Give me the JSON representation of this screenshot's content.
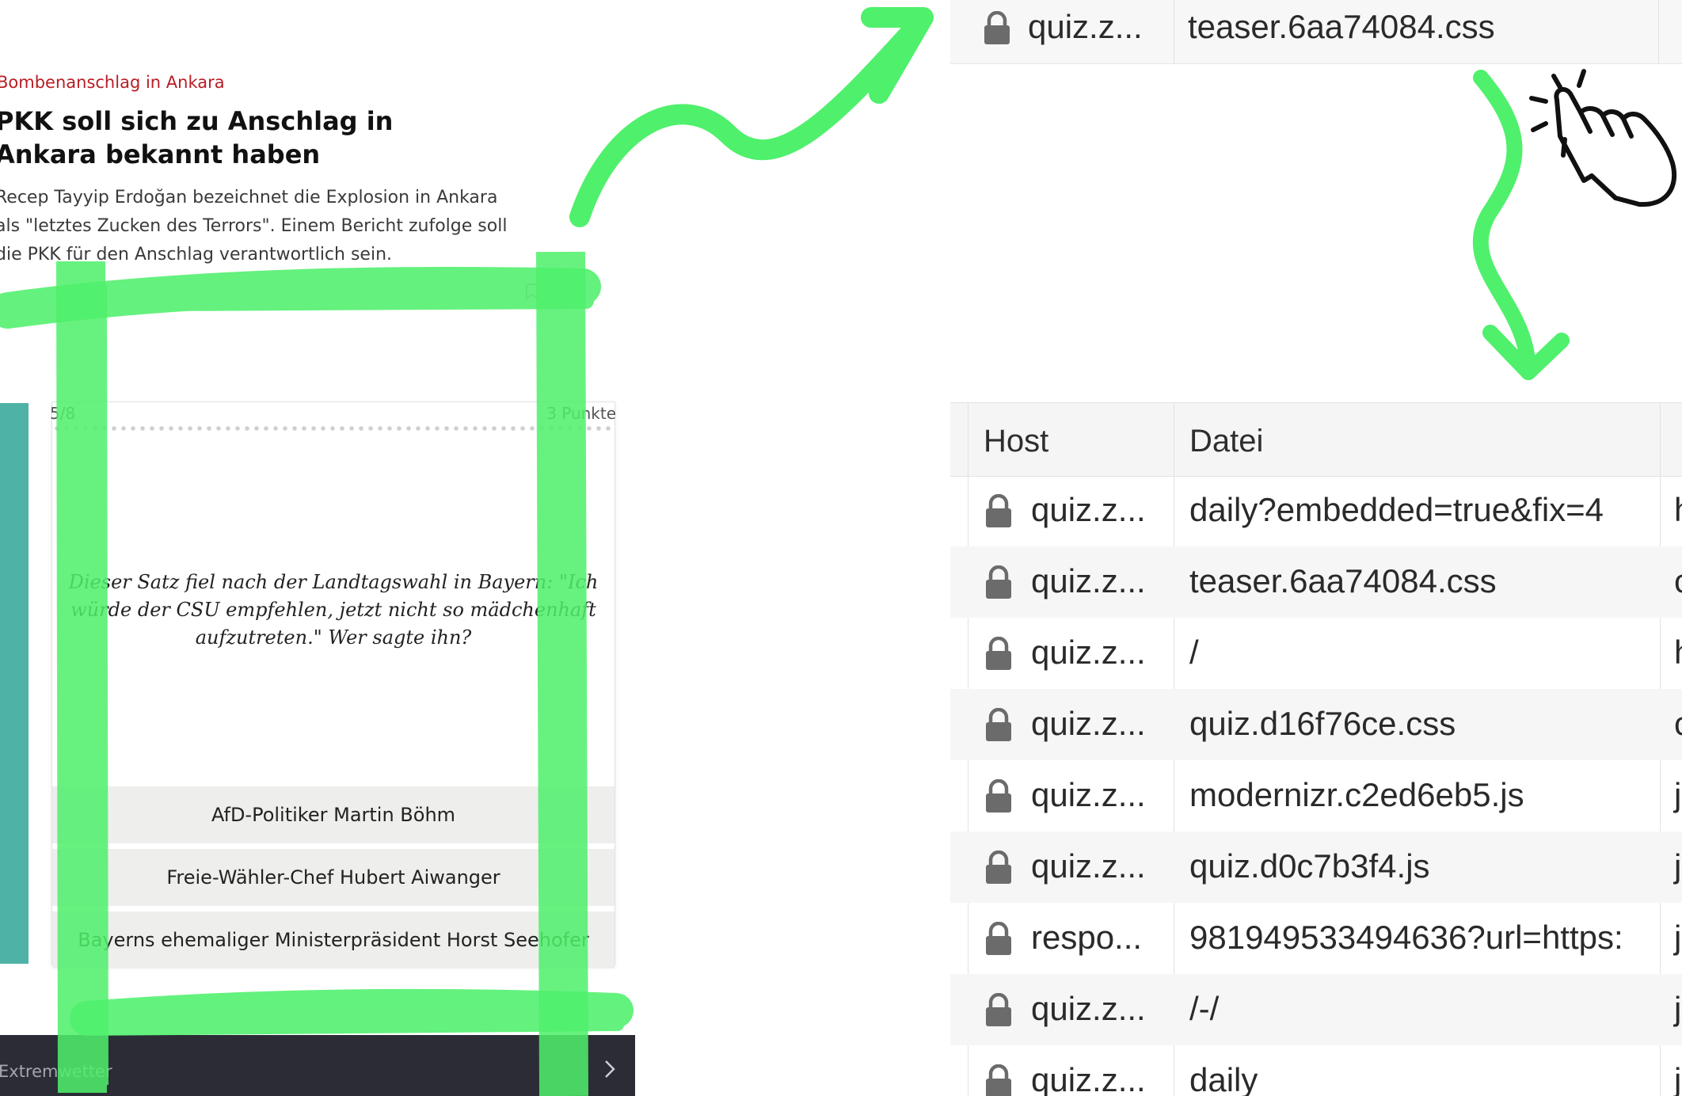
{
  "article": {
    "kicker": "Bombenanschlag in Ankara",
    "headline": "PKK soll sich zu Anschlag in Ankara bekannt haben",
    "teaser": "Recep Tayyip Erdoğan bezeichnet die Explosion in Ankara als \"letztes Zucken des Terrors\". Einem Bericht zufolge soll die PKK für den Anschlag verantwortlich sein."
  },
  "quiz": {
    "progress": "5/8",
    "points": "3 Punkte",
    "question": "Dieser Satz fiel nach der Landtagswahl in Bayern: \"Ich würde der CSU empfehlen, jetzt nicht so mädchenhaft aufzutreten.\" Wer sagte ihn?",
    "answers": [
      "AfD-Politiker Martin Böhm",
      "Freie-Wähler-Chef Hubert Aiwanger",
      "Bayerns ehemaliger Ministerpräsident Horst Seehofer"
    ]
  },
  "bottom_bar": {
    "label": "Extremwetter",
    "arrow_icon": "chevron-right-icon"
  },
  "network_top_row": {
    "host": "quiz.z...",
    "file": "teaser.6aa74084.css"
  },
  "network_table": {
    "headers": {
      "host": "Host",
      "file": "Datei"
    },
    "rows": [
      {
        "host": "quiz.z...",
        "file": "daily?embedded=true&fix=4",
        "type": "h"
      },
      {
        "host": "quiz.z...",
        "file": "teaser.6aa74084.css",
        "type": "c"
      },
      {
        "host": "quiz.z...",
        "file": "/",
        "type": "h"
      },
      {
        "host": "quiz.z...",
        "file": "quiz.d16f76ce.css",
        "type": "c"
      },
      {
        "host": "quiz.z...",
        "file": "modernizr.c2ed6eb5.js",
        "type": "j"
      },
      {
        "host": "quiz.z...",
        "file": "quiz.d0c7b3f4.js",
        "type": "j"
      },
      {
        "host": "respo...",
        "file": "981949533494636?url=https:",
        "type": "j"
      },
      {
        "host": "quiz.z...",
        "file": "/-/",
        "type": "j"
      },
      {
        "host": "quiz.z...",
        "file": "daily",
        "type": "j"
      }
    ]
  },
  "colors": {
    "highlight_green": "#4ff06c",
    "kicker_red": "#b81d24",
    "teal": "#4fb2a6",
    "bottom_bar": "#2b2c36"
  }
}
